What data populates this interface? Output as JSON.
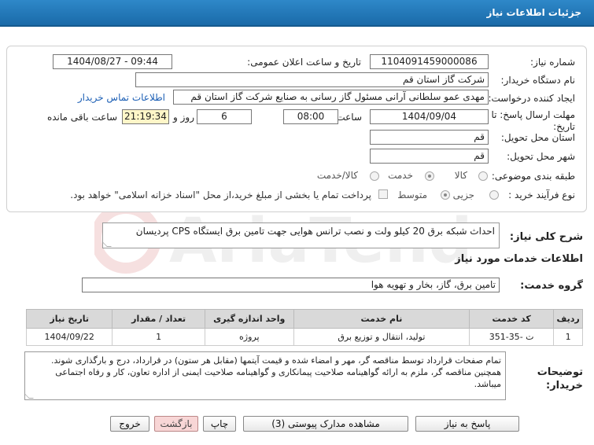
{
  "header": {
    "title": "جزئیات اطلاعات نیاز"
  },
  "watermark": {
    "text": "AriaTender.net"
  },
  "form": {
    "need_number_label": "شماره نیاز:",
    "need_number": "1104091459000086",
    "announce_label": "تاریخ و ساعت اعلان عمومی:",
    "announce_value": "1404/08/27 - 09:44",
    "buyer_org_label": "نام دستگاه خریدار:",
    "buyer_org": "شرکت گاز استان قم",
    "requester_label": "ایجاد کننده درخواست:",
    "requester": "مهدی عمو سلطانی آرانی مسئول گاز رسانی به صنایع شرکت گاز استان قم",
    "contact_link": "اطلاعات تماس خریدار",
    "deadline_label_1": "مهلت ارسال پاسخ: تا",
    "deadline_label_2": "تاریخ:",
    "deadline_date": "1404/09/04",
    "time_label": "ساعت",
    "deadline_time": "08:00",
    "days_value": "6",
    "days_label": "روز و",
    "remaining_time": "21:19:34",
    "remaining_label": "ساعت باقی مانده",
    "delivery_province_label": "استان محل تحویل:",
    "delivery_province": "قم",
    "delivery_city_label": "شهر محل تحویل:",
    "delivery_city": "قم",
    "category_label": "طبقه بندی موضوعی:",
    "category_options": [
      "کالا",
      "خدمت",
      "کالا/خدمت"
    ],
    "purchase_type_label": "نوع فرآیند خرید :",
    "purchase_options": [
      "جزیی",
      "متوسط"
    ],
    "payment_note": "پرداخت تمام یا بخشی از مبلغ خرید،از محل \"اسناد خزانه اسلامی\" خواهد بود."
  },
  "summary": {
    "label": "شرح کلی نیاز:",
    "value": "احداث شبکه برق 20 کیلو ولت و نصب ترانس هوایی جهت تامین برق ایستگاه CPS پردیسان"
  },
  "services": {
    "section_title": "اطلاعات خدمات مورد نیاز",
    "group_label": "گروه خدمت:",
    "group_value": "تامین برق، گاز، بخار و تهویه هوا",
    "columns": [
      "ردیف",
      "کد خدمت",
      "نام خدمت",
      "واحد اندازه گیری",
      "تعداد / مقدار",
      "تاریخ نیاز"
    ],
    "rows": [
      [
        "1",
        "ت -35-351",
        "تولید، انتقال و توزیع برق",
        "پروژه",
        "1",
        "1404/09/22"
      ]
    ]
  },
  "notes": {
    "label_1": "توضیحات",
    "label_2": "خریدار:",
    "text": "تمام صفحات قرارداد توسط مناقصه گر، مهر و امضاء شده و قیمت آیتمها (مقابل هر ستون) در قرارداد، درج و بارگذاری شوند. همچنین مناقصه گر، ملزم به ارائه گواهینامه صلاحیت پیمانکاری و گواهینامه صلاحیت ایمنی از اداره تعاون، کار و رفاه اجتماعی میباشد."
  },
  "buttons": {
    "reply": "پاسخ به نیاز",
    "attachments": "مشاهده مدارک پیوستی (3)",
    "print": "چاپ",
    "back": "بازگشت",
    "exit": "خروج"
  }
}
